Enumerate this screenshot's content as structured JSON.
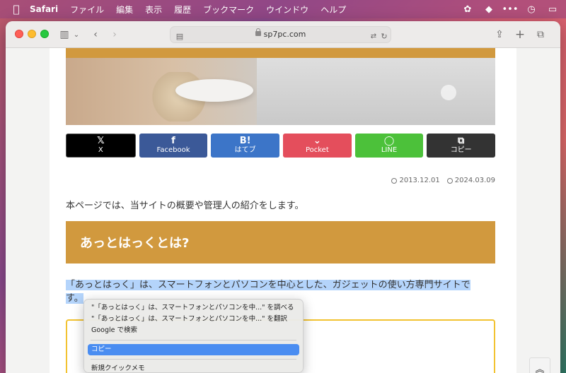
{
  "menubar": {
    "app": "Safari",
    "items": [
      "ファイル",
      "編集",
      "表示",
      "履歴",
      "ブックマーク",
      "ウインドウ",
      "ヘルプ"
    ]
  },
  "toolbar": {
    "url": "sp7pc.com"
  },
  "share": {
    "buttons": [
      {
        "glyph": "𝕏",
        "label": "X"
      },
      {
        "glyph": "f",
        "label": "Facebook"
      },
      {
        "glyph": "B!",
        "label": "はてブ"
      },
      {
        "glyph": "⌄",
        "label": "Pocket"
      },
      {
        "glyph": "◯",
        "label": "LINE"
      },
      {
        "glyph": "⧉",
        "label": "コピー"
      }
    ]
  },
  "article": {
    "published": "2013.12.01",
    "updated": "2024.03.09",
    "intro": "本ページでは、当サイトの概要や管理人の紹介をします。",
    "heading": "あっとはっくとは?",
    "para_line1": "「あっとはっく」は、スマートフォンとパソコンを中心とした、ガジェットの使い方専門サイトで",
    "para_line2": "す。"
  },
  "context_menu": {
    "items": [
      "\"「あっとはっく」は、スマートフォンとパソコンを中...\" を調べる",
      "\"「あっとはっく」は、スマートフォンとパソコンを中...\" を翻訳",
      "Google で検索",
      "コピー",
      "新規クイックメモ"
    ]
  }
}
